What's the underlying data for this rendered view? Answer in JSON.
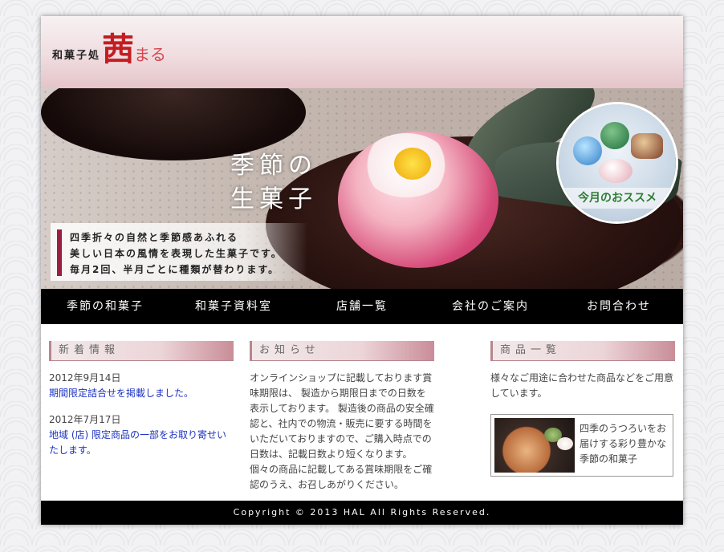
{
  "header": {
    "brand_prefix": "和菓子処",
    "logo_main": "茜",
    "logo_sub": "まる"
  },
  "hero": {
    "title_line1": "季節の",
    "title_line2": "生菓子",
    "caption": [
      "四季折々の自然と季節感あふれる",
      "美しい日本の風情を表現した生菓子です。",
      "毎月2回、半月ごとに種類が替わります。"
    ],
    "recommend_label": "今月のおススメ"
  },
  "nav": {
    "items": [
      "季節の和菓子",
      "和菓子資料室",
      "店舗一覧",
      "会社のご案内",
      "お問合わせ"
    ]
  },
  "news": {
    "heading": "新着情報",
    "items": [
      {
        "date": "2012年9月14日",
        "link": "期間限定詰合せを掲載しました。"
      },
      {
        "date": "2012年7月17日",
        "link": "地域 (店) 限定商品の一部をお取り寄せいたします。"
      }
    ]
  },
  "notice": {
    "heading": "お知らせ",
    "text": "オンラインショップに記載しております賞味期限は、 製造から期限日までの日数を表示しております。 製造後の商品の安全確認と、社内での物流・販売に要する時間を いただいておりますので、ご購入時点での日数は、記載日数より短くなります。 個々の商品に記載してある賞味期限をご確認のうえ、お召しあがりください。"
  },
  "products": {
    "heading": "商品一覧",
    "text": "様々なご用途に合わせた商品などをご用意しています。",
    "banner_text": "四季のうつろいをお届けする彩り豊かな季節の和菓子"
  },
  "footer": {
    "copyright": "Copyright ©  2013 HAL All Rights Reserved."
  }
}
